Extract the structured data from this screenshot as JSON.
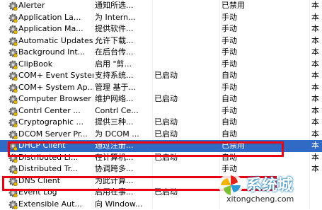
{
  "services": [
    {
      "name": "Alerter",
      "description": "通知所选...",
      "status": "",
      "startup": "已禁用",
      "logon": "本"
    },
    {
      "name": "Application La...",
      "description": "为 Intern...",
      "status": "",
      "startup": "手动",
      "logon": "本"
    },
    {
      "name": "Application Ma...",
      "description": "提供软件...",
      "status": "",
      "startup": "手动",
      "logon": "本"
    },
    {
      "name": "Automatic Updates",
      "description": "允许下载...",
      "status": "",
      "startup": "手动",
      "logon": "本"
    },
    {
      "name": "Background Int...",
      "description": "在后台传...",
      "status": "",
      "startup": "手动",
      "logon": "本"
    },
    {
      "name": "ClipBook",
      "description": "启用 \"剪...",
      "status": "",
      "startup": "手动",
      "logon": "本"
    },
    {
      "name": "COM+ Event System",
      "description": "支持系统...",
      "status": "已启动",
      "startup": "自动",
      "logon": "本"
    },
    {
      "name": "COM+ System Ap...",
      "description": "管理 基于...",
      "status": "",
      "startup": "手动",
      "logon": "本"
    },
    {
      "name": "Computer Browser",
      "description": "维护网络...",
      "status": "已启动",
      "startup": "自动",
      "logon": "本"
    },
    {
      "name": "Contrl Center ...",
      "description": "Contrl Ce...",
      "status": "",
      "startup": "手动",
      "logon": "本"
    },
    {
      "name": "Cryptographic ...",
      "description": "提供三种...",
      "status": "已启动",
      "startup": "自动",
      "logon": "本"
    },
    {
      "name": "DCOM Server Pr...",
      "description": "为 DCOM ...",
      "status": "已启动",
      "startup": "自动",
      "logon": "本"
    },
    {
      "name": "DHCP Client",
      "description": "通过注册...",
      "status": "",
      "startup": "已禁用",
      "logon": "本"
    },
    {
      "name": "Distributed Li...",
      "description": "在计算机...",
      "status": "已启动",
      "startup": "自动",
      "logon": "本"
    },
    {
      "name": "Distributed Tr...",
      "description": "协调跨多...",
      "status": "",
      "startup": "手动",
      "logon": "本"
    },
    {
      "name": "DNS Client",
      "description": "为此计算...",
      "status": "",
      "startup": "",
      "logon": ""
    },
    {
      "name": "Event Log",
      "description": "启用在事...",
      "status": "已启动",
      "startup": "",
      "logon": ""
    },
    {
      "name": "Extensible Aut...",
      "description": "向 Window...",
      "status": "",
      "startup": "",
      "logon": ""
    }
  ],
  "selected_row_index": 12,
  "watermark": {
    "brand": "系统城",
    "url": "xitongcheng.com"
  },
  "colors": {
    "selection": "#316ac5",
    "highlight_box": "#e60012"
  },
  "icons": {
    "service": "gear-icon",
    "watermark_logo": "pinwheel-logo-icon"
  }
}
